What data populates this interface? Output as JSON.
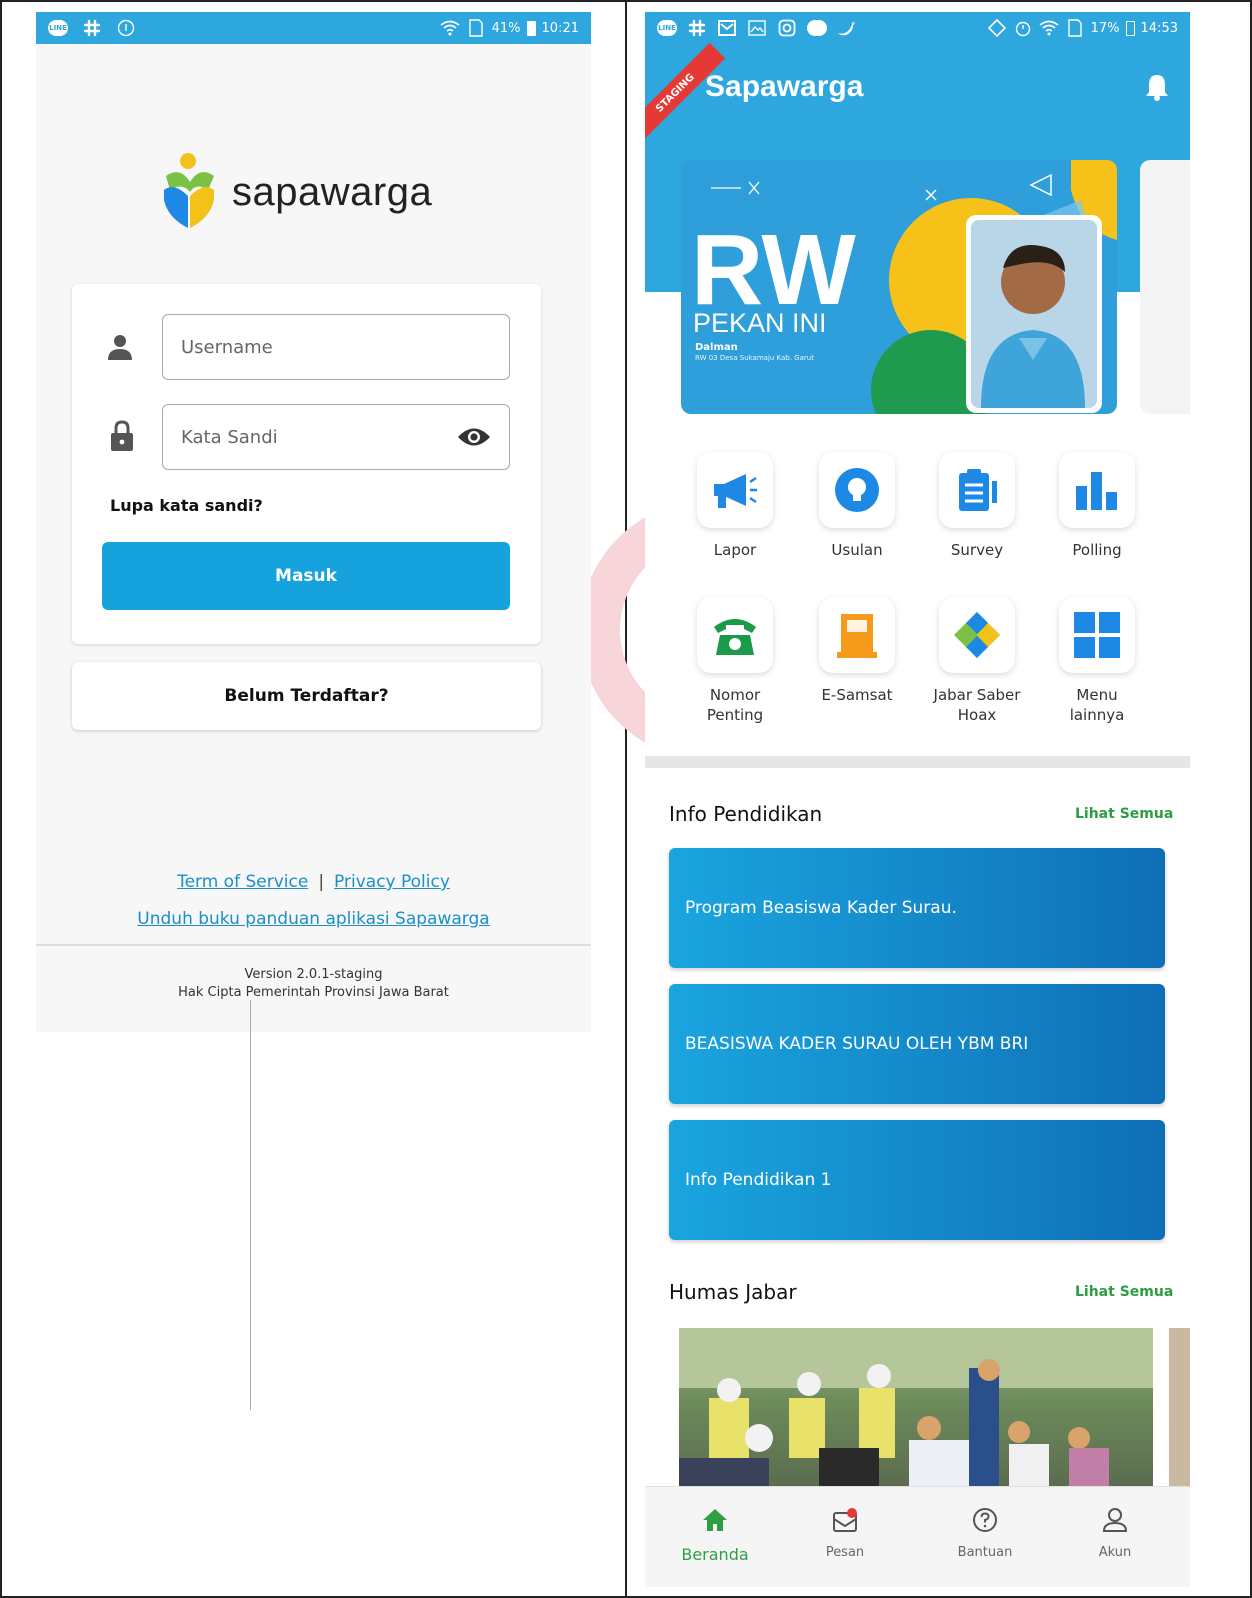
{
  "login": {
    "status_bar": {
      "line_badge": "LINE",
      "battery": "41%",
      "time": "10:21"
    },
    "logo_text": "sapawarga",
    "username_placeholder": "Username",
    "password_placeholder": "Kata Sandi",
    "forgot_label": "Lupa kata sandi?",
    "login_button": "Masuk",
    "register_label": "Belum Terdaftar?",
    "terms_link": "Term of Service",
    "separator": "|",
    "privacy_link": "Privacy Policy",
    "guide_link": "Unduh buku panduan aplikasi Sapawarga",
    "version": "Version 2.0.1-staging",
    "copyright": "Hak Cipta Pemerintah Provinsi Jawa Barat"
  },
  "home": {
    "status_bar": {
      "line_badge": "LINE",
      "battery": "17%",
      "time": "14:53"
    },
    "staging_ribbon": "STAGING",
    "app_title": "Sapawarga",
    "banner": {
      "title": "RW",
      "subtitle": "PEKAN INI",
      "name": "Dalman",
      "location": "RW 03 Desa Sukamaju Kab. Garut"
    },
    "menu": [
      {
        "label": "Lapor"
      },
      {
        "label": "Usulan"
      },
      {
        "label": "Survey"
      },
      {
        "label": "Polling"
      },
      {
        "label": "Nomor Penting"
      },
      {
        "label": "E-Samsat"
      },
      {
        "label": "Jabar Saber Hoax"
      },
      {
        "label": "Menu lainnya"
      }
    ],
    "info_section": {
      "title": "Info Pendidikan",
      "see_all": "Lihat Semua",
      "items": [
        "Program Beasiswa Kader Surau.",
        "BEASISWA KADER SURAU OLEH YBM BRI",
        "Info Pendidikan 1"
      ]
    },
    "humas_section": {
      "title": "Humas Jabar",
      "see_all": "Lihat Semua"
    },
    "nav": [
      {
        "label": "Beranda",
        "active": true
      },
      {
        "label": "Pesan"
      },
      {
        "label": "Bantuan"
      },
      {
        "label": "Akun"
      }
    ],
    "colors": {
      "primary": "#2ea7df",
      "button": "#16a2dc",
      "green": "#2e9d3f",
      "staging_red": "#e53935"
    }
  }
}
